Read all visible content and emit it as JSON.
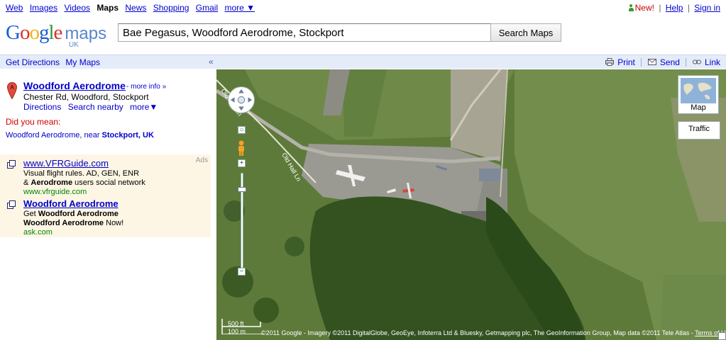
{
  "topnav": {
    "links": [
      "Web",
      "Images",
      "Videos",
      "Maps",
      "News",
      "Shopping",
      "Gmail",
      "more ▼"
    ],
    "selected": "Maps"
  },
  "topright": {
    "new_label": "New!",
    "help": "Help",
    "signin": "Sign in",
    "sep": "|"
  },
  "logo": {
    "google": "Google",
    "maps": "maps",
    "region": "UK"
  },
  "search": {
    "value": "Bae Pegasus, Woodford Aerodrome, Stockport",
    "button": "Search Maps"
  },
  "toolbar": {
    "get_directions": "Get Directions",
    "my_maps": "My Maps",
    "collapse": "«",
    "print": "Print",
    "send": "Send",
    "link": "Link"
  },
  "result": {
    "marker_letter": "A",
    "title": "Woodford Aerodrome",
    "more_info": "- more info »",
    "address": "Chester Rd, Woodford, Stockport",
    "actions": [
      "Directions",
      "Search nearby",
      "more▼"
    ]
  },
  "did_you_mean": {
    "label": "Did you mean:",
    "suggestion_prefix": "Woodford Aerodrome, near ",
    "suggestion_bold": "Stockport, UK"
  },
  "ads": {
    "label": "Ads",
    "items": [
      {
        "title": "www.VFRGuide.com",
        "line1": "Visual flight rules. AD, GEN, ENR",
        "line2_prefix": "& ",
        "line2_bold": "Aerodrome",
        "line2_suffix": " users social network",
        "url": "www.vfrguide.com"
      },
      {
        "title": "Woodford Aerodrome",
        "line1_prefix": "Get ",
        "line1_bold": "Woodford Aerodrome",
        "line2_bold": "Woodford Aerodrome",
        "line2_suffix": " Now!",
        "url": "ask.com"
      }
    ]
  },
  "map": {
    "type_button": "Map",
    "traffic_button": "Traffic",
    "road_label_1": "Old Hall Ln",
    "road_label_2": "Old Hall Ln",
    "scale_ft": "500 ft",
    "scale_m": "100 m",
    "copyright": "©2011 Google - Imagery ©2011 DigitalGlobe, GeoEye, Infoterra Ltd & Bluesky, Getmapping plc, The GeoInformation Group, Map data ©2011 Tele Atlas - ",
    "terms": "Terms of Use"
  },
  "colors": {
    "link": "#0000cc",
    "toolbar_bg": "#e5ecf9",
    "ads_bg": "#fdf6e5",
    "new_red": "#cc0000",
    "url_green": "#008800"
  }
}
